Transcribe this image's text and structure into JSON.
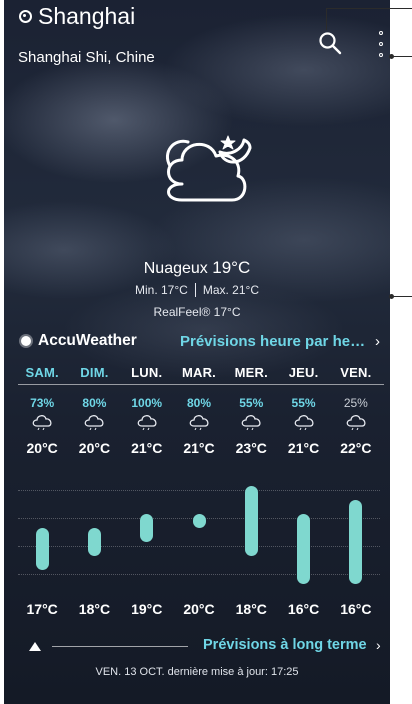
{
  "header": {
    "city": "Shanghai",
    "region": "Shanghai Shi, Chine",
    "search_icon": "search-icon",
    "more_icon": "more-vert-icon"
  },
  "current": {
    "icon": "partly-cloudy-night-icon",
    "condition": "Nuageux",
    "temperature": "19°C",
    "min": "Min. 17°C",
    "max": "Max. 21°C",
    "realfeel": "RealFeel® 17°C"
  },
  "brand": {
    "name": "AccuWeather",
    "hourly_link": "Prévisions heure par he…",
    "chevron": "›"
  },
  "forecast": {
    "days": [
      "SAM.",
      "DIM.",
      "LUN.",
      "MAR.",
      "MER.",
      "JEU.",
      "VEN."
    ],
    "highlighted_days": [
      0,
      1
    ],
    "precip": [
      "73%",
      "80%",
      "100%",
      "80%",
      "55%",
      "55%",
      "25%"
    ],
    "highs": [
      "20°C",
      "20°C",
      "21°C",
      "21°C",
      "23°C",
      "21°C",
      "22°C"
    ],
    "lows": [
      "17°C",
      "18°C",
      "19°C",
      "20°C",
      "18°C",
      "16°C",
      "16°C"
    ],
    "bar_color": "#7fd8cf",
    "accent_color": "#6fd6e6"
  },
  "chart_data": {
    "type": "bar",
    "categories": [
      "SAM.",
      "DIM.",
      "LUN.",
      "MAR.",
      "MER.",
      "JEU.",
      "VEN."
    ],
    "series": [
      {
        "values_low": [
          17,
          18,
          19,
          20,
          18,
          16,
          16
        ],
        "values_high": [
          20,
          20,
          21,
          21,
          23,
          21,
          22
        ]
      }
    ],
    "ylim": [
      16,
      23
    ]
  },
  "footer": {
    "long_term_link": "Prévisions à long terme",
    "chevron": "›",
    "updated": "VEN. 13 OCT. dernière mise à jour: 17:25"
  }
}
